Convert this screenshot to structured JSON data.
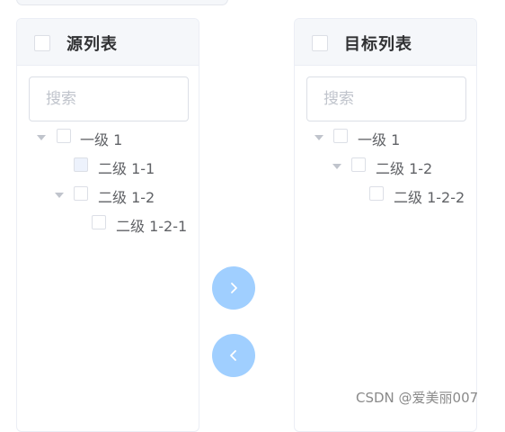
{
  "source_panel": {
    "title": "源列表",
    "search_placeholder": "搜索",
    "nodes": [
      {
        "label": "一级 1"
      },
      {
        "label": "二级 1-1"
      },
      {
        "label": "二级 1-2"
      },
      {
        "label": "二级 1-2-1"
      }
    ]
  },
  "target_panel": {
    "title": "目标列表",
    "search_placeholder": "搜索",
    "nodes": [
      {
        "label": "一级 1"
      },
      {
        "label": "二级 1-2"
      },
      {
        "label": "二级 1-2-2"
      }
    ]
  },
  "buttons": {
    "to_target_icon": "chevron-right-icon",
    "to_source_icon": "chevron-left-icon",
    "color": "#a0cfff"
  },
  "watermark": "CSDN @爱美丽007"
}
